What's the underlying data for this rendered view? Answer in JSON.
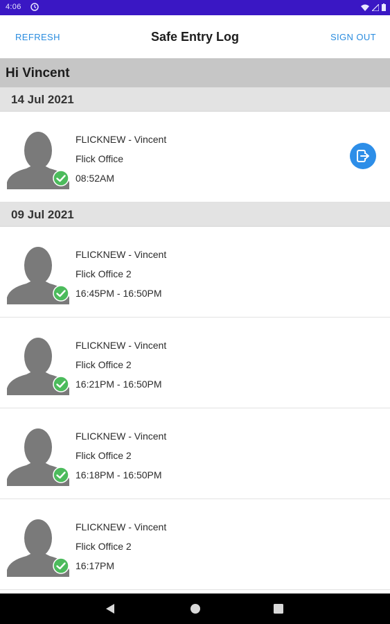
{
  "status_bar": {
    "time": "4:06"
  },
  "header": {
    "refresh_label": "REFRESH",
    "title": "Safe Entry Log",
    "signout_label": "SIGN OUT"
  },
  "greeting": "Hi Vincent",
  "groups": [
    {
      "date": "14 Jul 2021",
      "entries": [
        {
          "name": "FLICKNEW - Vincent",
          "location": "Flick Office",
          "time": "08:52AM",
          "status_icon": "check-circle-icon",
          "action_icon": "checkout-icon"
        }
      ]
    },
    {
      "date": "09 Jul 2021",
      "entries": [
        {
          "name": "FLICKNEW - Vincent",
          "location": "Flick Office 2",
          "time": "16:45PM - 16:50PM",
          "status_icon": "check-circle-icon"
        },
        {
          "name": "FLICKNEW - Vincent",
          "location": "Flick Office 2",
          "time": "16:21PM - 16:50PM",
          "status_icon": "check-circle-icon"
        },
        {
          "name": "FLICKNEW - Vincent",
          "location": "Flick Office 2",
          "time": "16:18PM - 16:50PM",
          "status_icon": "check-circle-icon"
        },
        {
          "name": "FLICKNEW - Vincent",
          "location": "Flick Office 2",
          "time": "16:17PM",
          "status_icon": "check-circle-icon"
        }
      ]
    }
  ],
  "colors": {
    "status_bar": "#3a17c4",
    "accent": "#2a8cdf",
    "check_green": "#4cbb5c",
    "avatar_gray": "#7a7a7a"
  }
}
